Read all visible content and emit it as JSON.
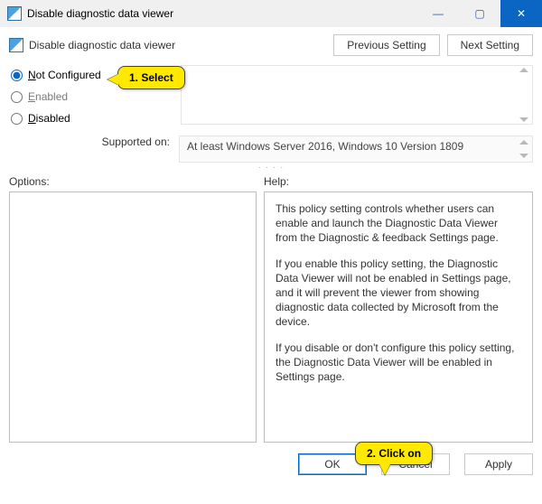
{
  "window": {
    "title": "Disable diagnostic data viewer",
    "controls": {
      "min": "—",
      "max": "▢",
      "close": "✕"
    }
  },
  "header": {
    "heading": "Disable diagnostic data viewer",
    "previous_setting": "Previous Setting",
    "next_setting": "Next Setting"
  },
  "radios": {
    "not_configured": "Not Configured",
    "enabled": "Enabled",
    "disabled": "Disabled",
    "selected": "not_configured"
  },
  "supported": {
    "label": "Supported on:",
    "value": "At least Windows Server 2016, Windows 10 Version 1809"
  },
  "labels": {
    "options": "Options:",
    "help": "Help:"
  },
  "help": {
    "p1": "This policy setting controls whether users can enable and launch the Diagnostic Data Viewer from the Diagnostic & feedback Settings page.",
    "p2": "If you enable this policy setting, the Diagnostic Data Viewer will not be enabled in Settings page, and it will prevent the viewer from showing diagnostic data collected by Microsoft from the device.",
    "p3": "If you disable or don't configure this policy setting, the Diagnostic Data Viewer will be enabled in Settings page."
  },
  "footer": {
    "ok": "OK",
    "cancel": "Cancel",
    "apply": "Apply"
  },
  "annotations": {
    "select": "1. Select",
    "click": "2. Click on"
  }
}
